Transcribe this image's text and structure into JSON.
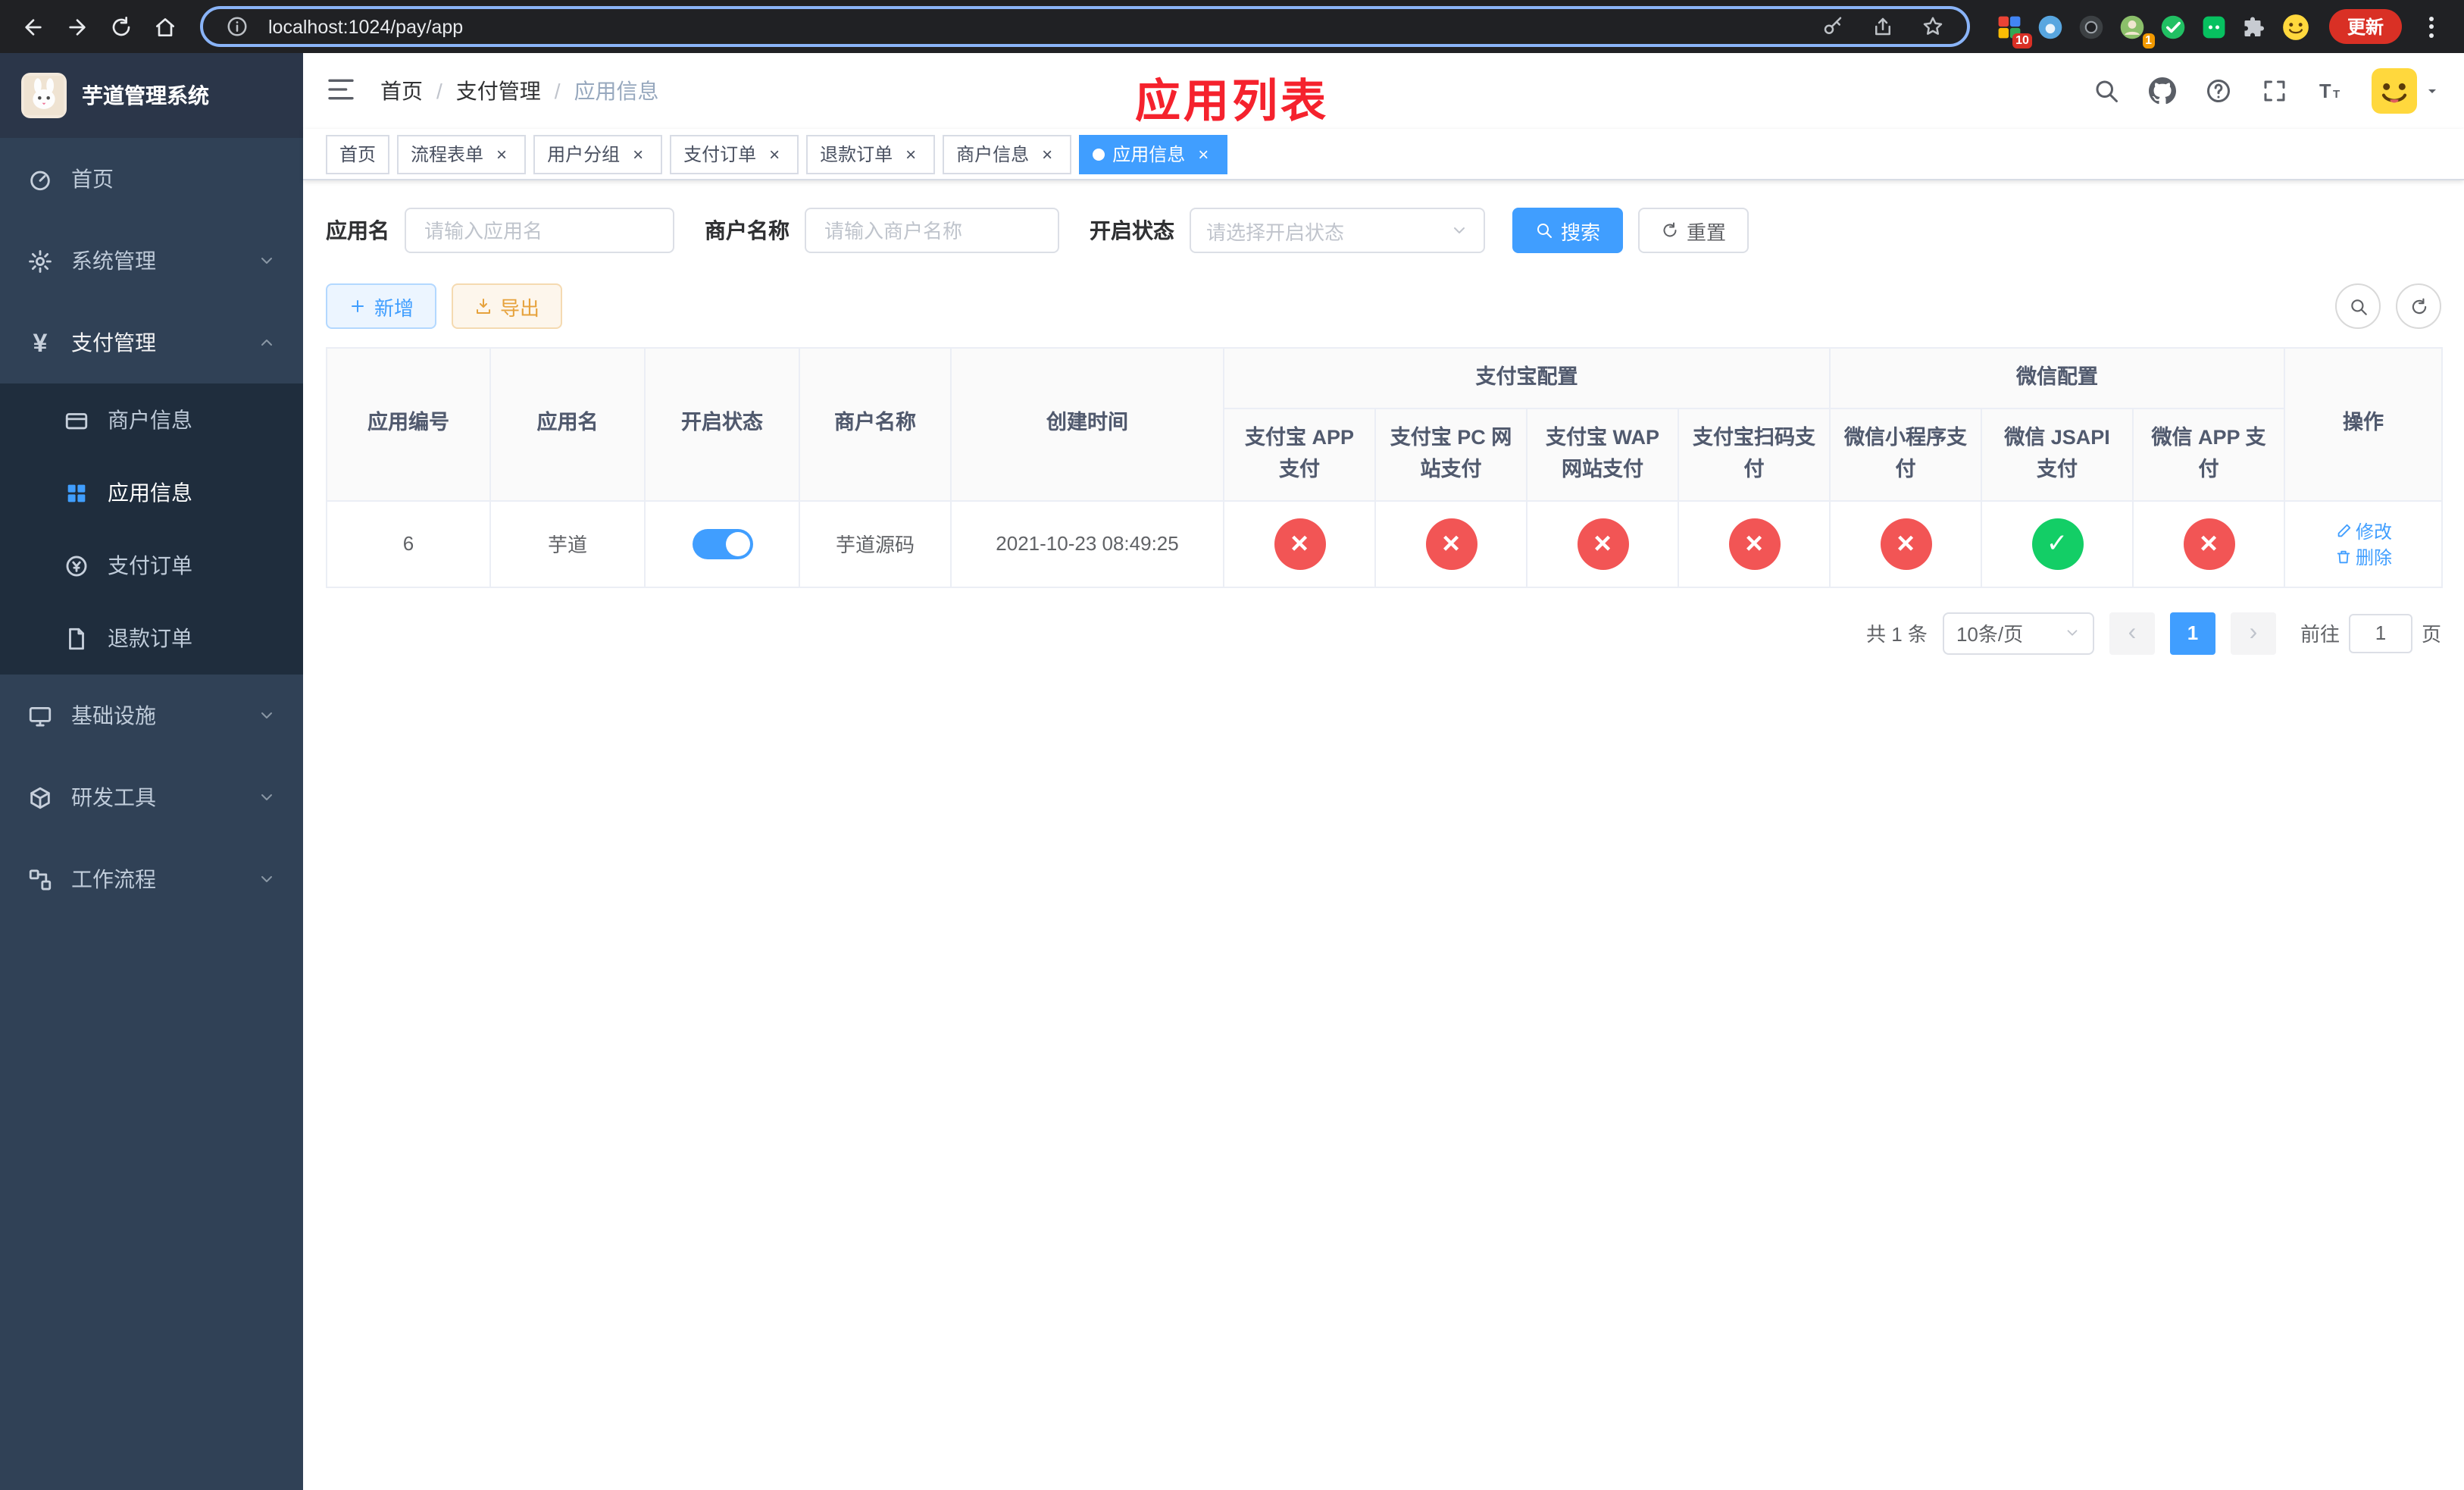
{
  "colors": {
    "accent": "#409eff",
    "danger": "#f25555",
    "success": "#13ce66",
    "warning": "#e6a23c",
    "page_title_red": "#f5222d",
    "sidebar_bg": "#304156",
    "submenu_bg": "#1f2d3d"
  },
  "browser": {
    "url": "localhost:1024/pay/app",
    "update_label": "更新",
    "ext_badge_a": "10",
    "ext_badge_b": "1"
  },
  "sidebar": {
    "title": "芋道管理系统",
    "home": "首页",
    "system": "系统管理",
    "payment": "支付管理",
    "merchant_info": "商户信息",
    "app_info": "应用信息",
    "pay_order": "支付订单",
    "refund_order": "退款订单",
    "infra": "基础设施",
    "dev_tools": "研发工具",
    "workflow": "工作流程"
  },
  "navbar": {
    "breadcrumb": [
      "首页",
      "支付管理",
      "应用信息"
    ],
    "breadcrumb_sep": "/",
    "page_title": "应用列表"
  },
  "tabs": [
    {
      "label": "首页"
    },
    {
      "label": "流程表单"
    },
    {
      "label": "用户分组"
    },
    {
      "label": "支付订单"
    },
    {
      "label": "退款订单"
    },
    {
      "label": "商户信息"
    },
    {
      "label": "应用信息"
    }
  ],
  "filters": {
    "app_name_label": "应用名",
    "app_name_placeholder": "请输入应用名",
    "merchant_label": "商户名称",
    "merchant_placeholder": "请输入商户名称",
    "status_label": "开启状态",
    "status_placeholder": "请选择开启状态",
    "search_button": "搜索",
    "reset_button": "重置"
  },
  "toolbar": {
    "add_button": "新增",
    "export_button": "导出"
  },
  "table": {
    "headers": {
      "app_id": "应用编号",
      "app_name": "应用名",
      "status": "开启状态",
      "merchant": "商户名称",
      "create_time": "创建时间",
      "alipay_group": "支付宝配置",
      "alipay_app": "支付宝 APP 支付",
      "alipay_pc": "支付宝 PC 网站支付",
      "alipay_wap": "支付宝 WAP 网站支付",
      "alipay_qr": "支付宝扫码支付",
      "wechat_group": "微信配置",
      "wx_lite": "微信小程序支付",
      "wx_jsapi": "微信 JSAPI 支付",
      "wx_app": "微信 APP 支付",
      "ops": "操作"
    },
    "rows": [
      {
        "app_id": "6",
        "app_name": "芋道",
        "enabled": true,
        "merchant": "芋道源码",
        "create_time": "2021-10-23 08:49:25",
        "alipay_app": false,
        "alipay_pc": false,
        "alipay_wap": false,
        "alipay_qr": false,
        "wx_lite": false,
        "wx_jsapi": true,
        "wx_app": false,
        "edit_label": "修改",
        "delete_label": "删除"
      }
    ]
  },
  "pagination": {
    "total": "共 1 条",
    "page_size": "10条/页",
    "page": "1",
    "goto_label": "前往",
    "goto_value": "1",
    "goto_unit": "页"
  }
}
